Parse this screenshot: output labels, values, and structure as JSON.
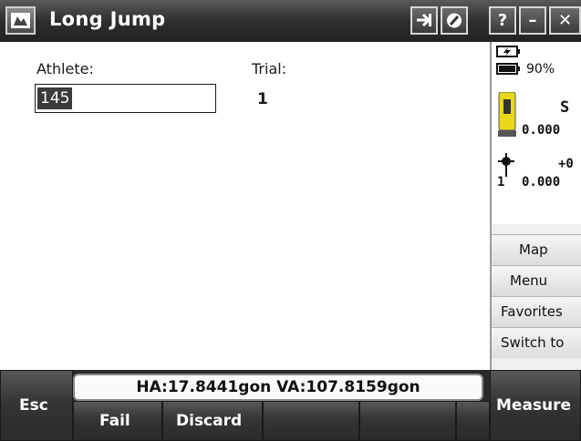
{
  "app": {
    "title": "Long Jump"
  },
  "titlebar": {
    "buttons": [
      {
        "name": "enter-icon",
        "glyph": "➔"
      },
      {
        "name": "settings-circle-icon",
        "glyph": "⊘"
      },
      {
        "name": "help-icon",
        "glyph": "?"
      },
      {
        "name": "minimize-icon",
        "glyph": "–"
      },
      {
        "name": "close-icon",
        "glyph": "✕"
      }
    ]
  },
  "form": {
    "athlete_label": "Athlete:",
    "athlete_value": "145",
    "trial_label": "Trial:",
    "trial_value": "1"
  },
  "status": {
    "battery_percent": "90%",
    "instrument_label": "S",
    "instrument_value": "0.000",
    "target_label": "+0",
    "target_value": "0.000",
    "target_count": "1"
  },
  "side_menu": [
    "Map",
    "Menu",
    "Favorites",
    "Switch to"
  ],
  "angles": {
    "text": "HA:17.8441gon  VA:107.8159gon"
  },
  "softkeys": {
    "esc": "Esc",
    "fail": "Fail",
    "discard": "Discard",
    "measure": "Measure"
  }
}
